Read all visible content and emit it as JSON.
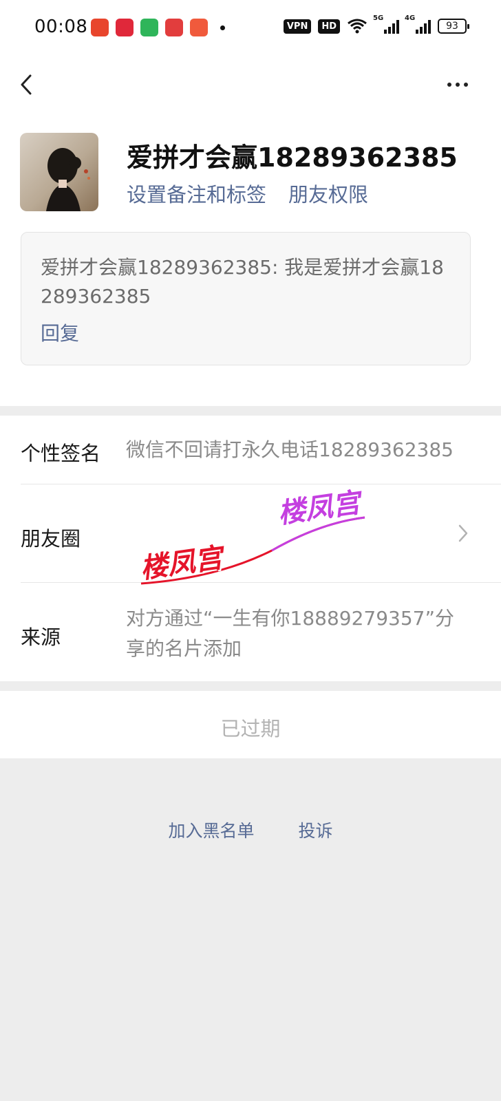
{
  "status_bar": {
    "time": "00:08",
    "app_icons": [
      "app-icon-1",
      "app-icon-2",
      "app-icon-3",
      "app-icon-4",
      "app-icon-5"
    ],
    "vpn": "VPN",
    "hd": "HD",
    "signal_5g": "5G",
    "signal_4g": "4G",
    "battery": "93"
  },
  "nav": {
    "back_icon": "chevron-left-icon",
    "more_icon": "more-dots-icon"
  },
  "profile": {
    "name": "爱拼才会赢18289362385",
    "set_remark_label": "设置备注和标签",
    "friend_permission_label": "朋友权限",
    "message": "爱拼才会赢18289362385: 我是爱拼才会赢18289362385",
    "reply_label": "回复"
  },
  "info_rows": {
    "signature_label": "个性签名",
    "signature_value": "微信不回请打永久电话18289362385",
    "moments_label": "朋友圈",
    "source_label": "来源",
    "source_value": "对方通过“一生有你18889279357”分享的名片添加"
  },
  "watermark": {
    "text1": "楼凤宫",
    "text2": "楼凤宫"
  },
  "expired_label": "已过期",
  "bottom_links": {
    "blacklist": "加入黑名单",
    "complain": "投诉"
  },
  "colors": {
    "link": "#576b95",
    "background": "#ededed"
  }
}
